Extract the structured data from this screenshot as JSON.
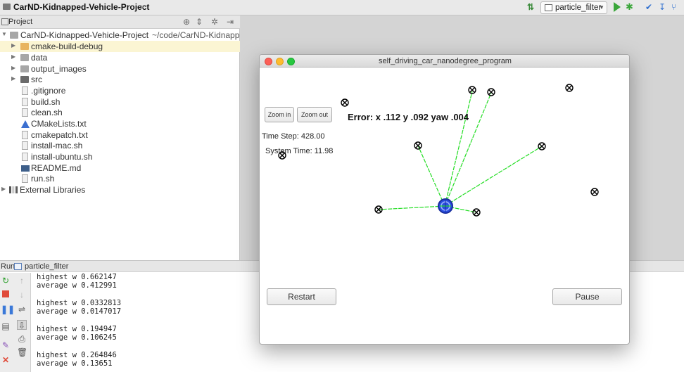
{
  "navbar": {
    "project_name": "CarND-Kidnapped-Vehicle-Project",
    "run_config": "particle_filter"
  },
  "project_panel": {
    "header_label": "Project",
    "root": {
      "name": "CarND-Kidnapped-Vehicle-Project",
      "path": "~/code/CarND-Kidnapp"
    },
    "items": [
      {
        "label": "cmake-build-debug",
        "icon": "folder-open-icon"
      },
      {
        "label": "data",
        "icon": "folder-icon"
      },
      {
        "label": "output_images",
        "icon": "folder-icon"
      },
      {
        "label": "src",
        "icon": "folder-icon"
      },
      {
        "label": ".gitignore",
        "icon": "file-icon"
      },
      {
        "label": "build.sh",
        "icon": "file-icon"
      },
      {
        "label": "clean.sh",
        "icon": "file-icon"
      },
      {
        "label": "CMakeLists.txt",
        "icon": "cmake-icon"
      },
      {
        "label": "cmakepatch.txt",
        "icon": "file-icon"
      },
      {
        "label": "install-mac.sh",
        "icon": "file-icon"
      },
      {
        "label": "install-ubuntu.sh",
        "icon": "file-icon"
      },
      {
        "label": "README.md",
        "icon": "markdown-icon"
      },
      {
        "label": "run.sh",
        "icon": "file-icon"
      }
    ],
    "external_libraries": "External Libraries"
  },
  "run_panel": {
    "label": "Run",
    "config_name": "particle_filter",
    "console_lines": [
      "highest w 0.662147",
      "average w 0.412991",
      "",
      "highest w 0.0332813",
      "average w 0.0147017",
      "",
      "highest w 0.194947",
      "average w 0.106245",
      "",
      "highest w 0.264846",
      "average w 0.13651"
    ]
  },
  "simulator": {
    "title": "self_driving_car_nanodegree_program",
    "zoom_in_label": "Zoom in",
    "zoom_out_label": "Zoom out",
    "error_text": "Error: x .112 y .092 yaw .004",
    "time_step": "Time Step: 428.00",
    "system_time": "System Time: 11.98",
    "restart_label": "Restart",
    "pause_label": "Pause",
    "colors": {
      "observation_lines": "#22dd22",
      "vehicle": "#1f3fd6",
      "landmark": "#000000"
    }
  }
}
